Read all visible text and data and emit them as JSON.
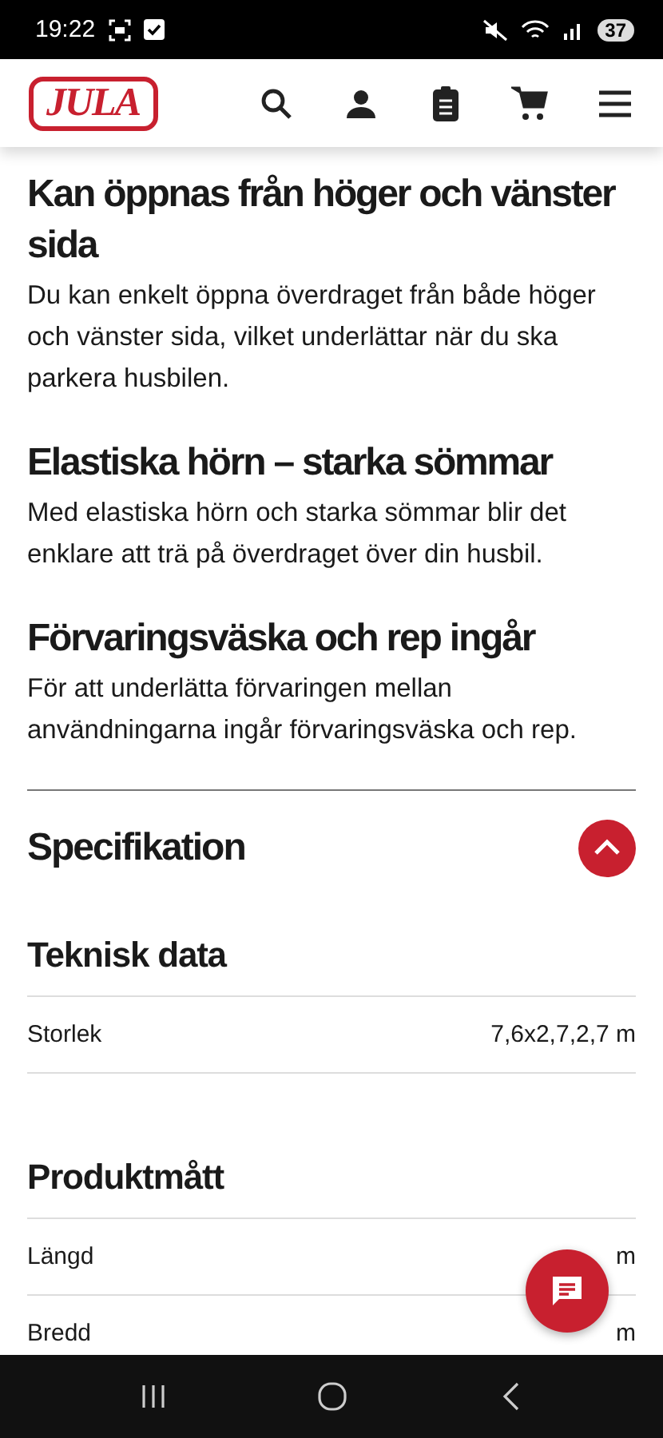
{
  "status_bar": {
    "time": "19:22",
    "battery": "37"
  },
  "header": {
    "logo": "JULA"
  },
  "sections": [
    {
      "heading": "Kan öppnas från höger och vänster sida",
      "body": "Du kan enkelt öppna överdraget från både höger och vänster sida, vilket underlättar när du ska parkera husbilen."
    },
    {
      "heading": "Elastiska hörn – starka sömmar",
      "body": "Med elastiska hörn och starka sömmar blir det enklare att trä på överdraget över din husbil."
    },
    {
      "heading": "Förvaringsväska och rep ingår",
      "body": "För att underlätta förvaringen mellan användningarna ingår förvaringsväska och rep."
    }
  ],
  "specification": {
    "title": "Specifikation",
    "expanded": true,
    "groups": [
      {
        "title": "Teknisk data",
        "rows": [
          {
            "label": "Storlek",
            "value": "7,6x2,7,2,7 m"
          }
        ]
      },
      {
        "title": "Produktmått",
        "rows": [
          {
            "label": "Längd",
            "value": "m"
          },
          {
            "label": "Bredd",
            "value": "m"
          }
        ]
      }
    ]
  }
}
